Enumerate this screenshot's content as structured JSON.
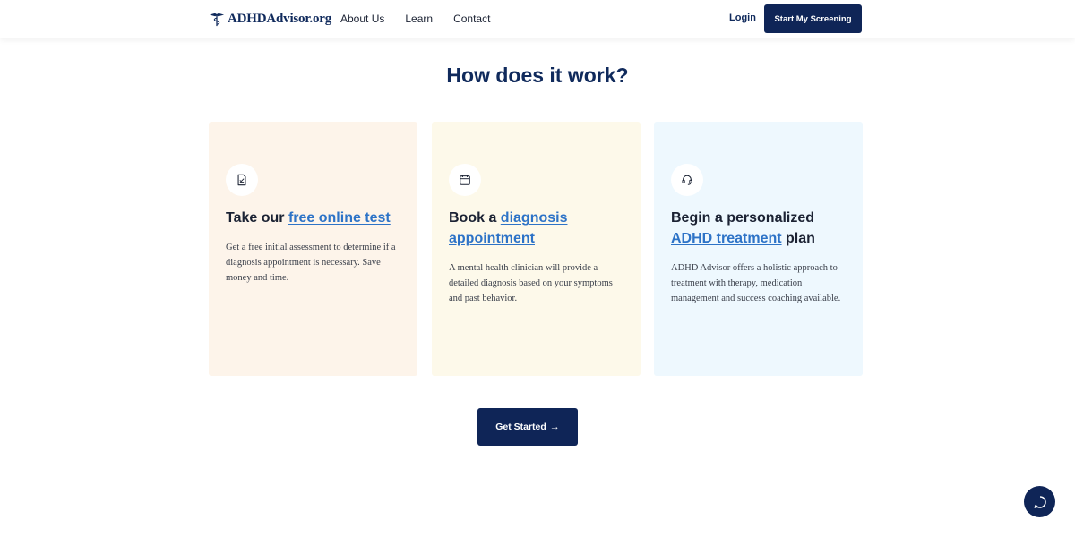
{
  "header": {
    "logo_text": "ADHDAdvisor.org",
    "nav": [
      "About Us",
      "Learn",
      "Contact"
    ],
    "login_label": "Login",
    "cta_label": "Start My Screening"
  },
  "section": {
    "title": "How does it work?"
  },
  "cards": [
    {
      "icon": "document-icon",
      "title_prefix": "Take our ",
      "title_link": "free online test",
      "title_suffix": "",
      "description": "Get a free initial assessment to determine if a diagnosis appointment is necessary. Save money and time."
    },
    {
      "icon": "calendar-icon",
      "title_prefix": "Book a ",
      "title_link": "diagnosis appointment",
      "title_suffix": "",
      "description": "A mental health clinician will provide a detailed diagnosis based on your symptoms and past behavior."
    },
    {
      "icon": "support-icon",
      "title_prefix": "Begin a personalized ",
      "title_link": "ADHD treatment",
      "title_suffix": " plan",
      "description": "ADHD Advisor offers a holistic approach to treatment with therapy, medication management and success coaching available."
    }
  ],
  "cta": {
    "label": "Get Started",
    "arrow": "→"
  },
  "colors": {
    "brand_navy": "#0f2557",
    "link_blue": "#2d73c7",
    "card_1_bg": "#fdf4ea",
    "card_2_bg": "#fdf9ea",
    "card_3_bg": "#eef8fe"
  }
}
